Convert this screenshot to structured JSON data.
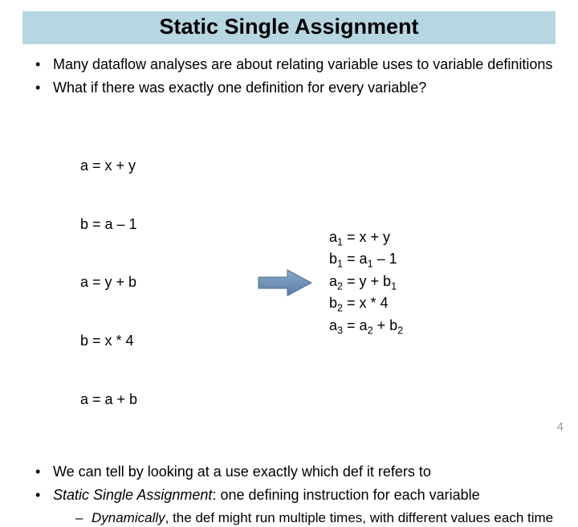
{
  "title": "Static Single Assignment",
  "bullets_top": [
    "Many dataflow analyses are about relating variable uses to variable definitions",
    "What if there was exactly one definition for every variable?"
  ],
  "code_left": [
    "a = x + y",
    "b = a – 1",
    "a = y + b",
    "b = x * 4",
    "a = a + b"
  ],
  "code_right": [
    {
      "lhs_var": "a",
      "lhs_sub": "1",
      "rhs": " = x + y"
    },
    {
      "lhs_var": "b",
      "lhs_sub": "1",
      "rhs_pre": " = a",
      "rhs_sub": "1",
      "rhs_post": " – 1"
    },
    {
      "lhs_var": "a",
      "lhs_sub": "2",
      "rhs_pre": " = y + b",
      "rhs_sub": "1",
      "rhs_post": ""
    },
    {
      "lhs_var": "b",
      "lhs_sub": "2",
      "rhs": " = x * 4"
    },
    {
      "lhs_var": "a",
      "lhs_sub": "3",
      "rhs_pre": " = a",
      "rhs_sub": "2",
      "rhs_mid": " + b",
      "rhs_sub2": "2",
      "rhs_post": ""
    }
  ],
  "bullets_bottom": [
    {
      "text_pre": "We can tell by looking at a use exactly which def it refers to"
    },
    {
      "em": "Static Single Assignment",
      "text_post": ": one defining instruction for each variable",
      "sub": {
        "em": "Dynamically",
        "text_post": ", the def might run multiple times, with different values each time"
      }
    }
  ],
  "page_number": "4",
  "arrow_color": "#6e8fb3"
}
